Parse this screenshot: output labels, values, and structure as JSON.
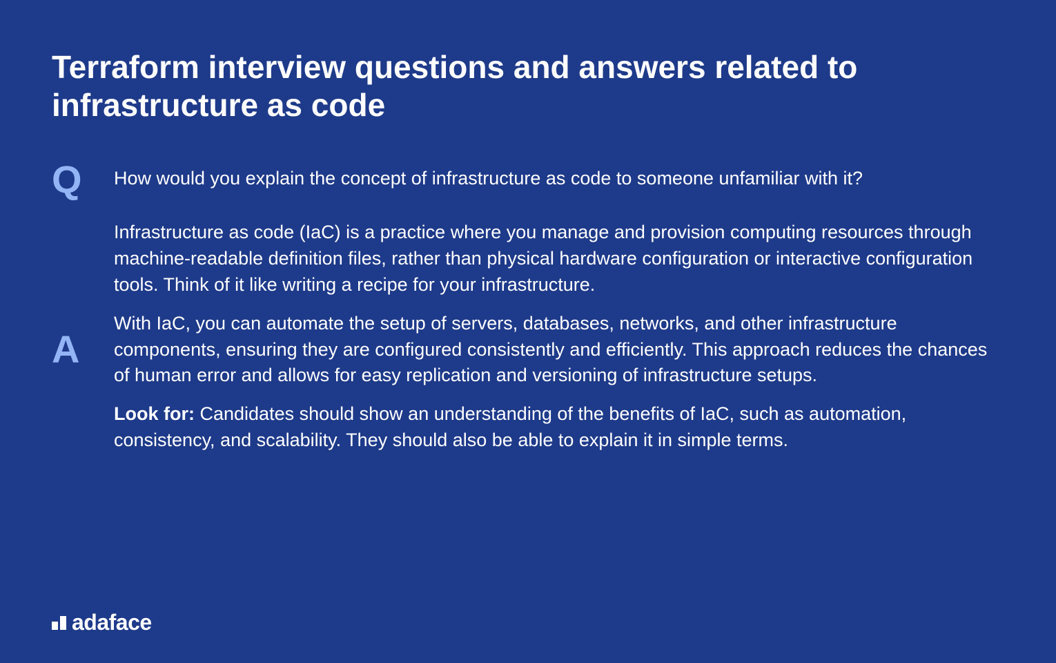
{
  "title": "Terraform interview questions and answers related to infrastructure as code",
  "question": {
    "label": "Q",
    "text": "How would you explain the concept of infrastructure as code to someone unfamiliar with it?"
  },
  "answer": {
    "label": "A",
    "paragraph1": "Infrastructure as code (IaC) is a practice where you manage and provision computing resources through machine-readable definition files, rather than physical hardware configuration or interactive configuration tools. Think of it like writing a recipe for your infrastructure.",
    "paragraph2": "With IaC, you can automate the setup of servers, databases, networks, and other infrastructure components, ensuring they are configured consistently and efficiently. This approach reduces the chances of human error and allows for easy replication and versioning of infrastructure setups.",
    "lookForLabel": "Look for:",
    "lookForText": " Candidates should show an understanding of the benefits of IaC, such as automation, consistency, and scalability. They should also be able to explain it in simple terms."
  },
  "logo": {
    "text": "adaface"
  }
}
